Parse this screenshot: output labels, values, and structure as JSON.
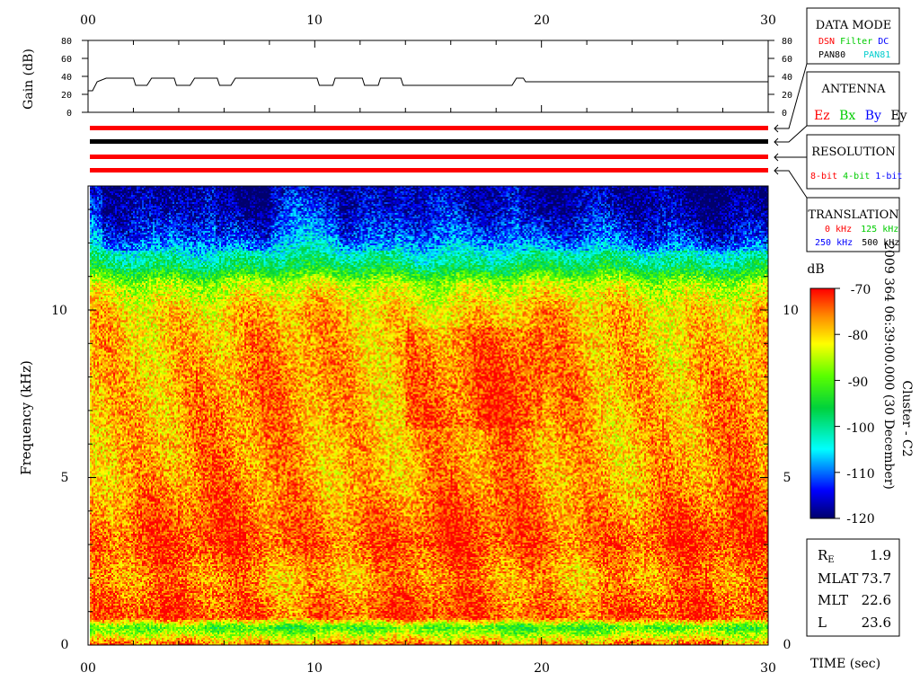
{
  "gain_panel": {
    "ylabel": "Gain (dB)",
    "yticks": [
      "0",
      "20",
      "40",
      "60",
      "80"
    ],
    "top_xticks": [
      "00",
      "10",
      "20",
      "30"
    ],
    "gain_profile": [
      [
        0,
        24
      ],
      [
        0.2,
        24
      ],
      [
        0.4,
        34
      ],
      [
        0.8,
        38
      ],
      [
        2,
        38
      ],
      [
        2.1,
        30
      ],
      [
        2.6,
        30
      ],
      [
        2.8,
        38
      ],
      [
        3.8,
        38
      ],
      [
        3.9,
        30
      ],
      [
        4.5,
        30
      ],
      [
        4.7,
        38
      ],
      [
        5.7,
        38
      ],
      [
        5.8,
        30
      ],
      [
        6.3,
        30
      ],
      [
        6.5,
        38
      ],
      [
        10.1,
        38
      ],
      [
        10.2,
        30
      ],
      [
        10.8,
        30
      ],
      [
        10.9,
        38
      ],
      [
        12.1,
        38
      ],
      [
        12.2,
        30
      ],
      [
        12.8,
        30
      ],
      [
        12.9,
        38
      ],
      [
        13.8,
        38
      ],
      [
        13.9,
        30
      ],
      [
        18.7,
        30
      ],
      [
        18.9,
        38
      ],
      [
        19.2,
        38
      ],
      [
        19.3,
        34
      ],
      [
        30,
        34
      ]
    ]
  },
  "status_bars": [
    {
      "color": "#ff0000"
    },
    {
      "color": "#000000"
    },
    {
      "color": "#ff0000"
    },
    {
      "color": "#ff0000"
    }
  ],
  "legend": {
    "data_mode": {
      "title": "DATA MODE",
      "items": [
        {
          "text": "DSN",
          "color": "#ff0000"
        },
        {
          "text": "Filter",
          "color": "#00cc00"
        },
        {
          "text": "DC",
          "color": "#0000ff"
        },
        {
          "text": "PAN80",
          "color": "#000000"
        },
        {
          "text": "PAN81",
          "color": "#00cccc"
        }
      ]
    },
    "antenna": {
      "title": "ANTENNA",
      "items": [
        {
          "text": "Ez",
          "color": "#ff0000"
        },
        {
          "text": "Bx",
          "color": "#00cc00"
        },
        {
          "text": "By",
          "color": "#0000ff"
        },
        {
          "text": "Ey",
          "color": "#000000"
        }
      ]
    },
    "resolution": {
      "title": "RESOLUTION",
      "items": [
        {
          "text": "8-bit",
          "color": "#ff0000"
        },
        {
          "text": "4-bit",
          "color": "#00cc00"
        },
        {
          "text": "1-bit",
          "color": "#0000ff"
        }
      ]
    },
    "translation": {
      "title": "TRANSLATION",
      "items": [
        {
          "text": "0 kHz",
          "color": "#ff0000"
        },
        {
          "text": "125 kHz",
          "color": "#00cc00"
        },
        {
          "text": "250 kHz",
          "color": "#0000ff"
        },
        {
          "text": "500 kHz",
          "color": "#000000"
        }
      ]
    }
  },
  "colorbar": {
    "label": "dB",
    "ticks": [
      "-70",
      "-80",
      "-90",
      "-100",
      "-110",
      "-120"
    ],
    "vmin": -120,
    "vmax": -70
  },
  "side_caption": {
    "line1": "2009 364 06:39:00.000 (30 December)",
    "line2": "Cluster - C2"
  },
  "orbit_table": [
    {
      "label_main": "R",
      "label_sub": "E",
      "value": "1.9"
    },
    {
      "label_main": "MLAT",
      "label_sub": "",
      "value": "73.7"
    },
    {
      "label_main": "MLT",
      "label_sub": "",
      "value": "22.6"
    },
    {
      "label_main": "L",
      "label_sub": "",
      "value": "23.6"
    }
  ],
  "chart_data": {
    "type": "heatmap",
    "xlabel": "TIME (sec)",
    "ylabel": "Frequency (kHz)",
    "xlim": [
      0,
      30
    ],
    "ylim": [
      0,
      13.7
    ],
    "xticks": [
      "00",
      "10",
      "20",
      "30"
    ],
    "yticks": [
      "0",
      "5",
      "10"
    ],
    "zlabel": "dB",
    "zlim": [
      -120,
      -70
    ],
    "colormap": "rainbow (blue low, red high)",
    "frequency_profile_db": [
      {
        "f": 0.0,
        "db": -76
      },
      {
        "f": 0.5,
        "db": -92
      },
      {
        "f": 0.8,
        "db": -73
      },
      {
        "f": 2.0,
        "db": -77
      },
      {
        "f": 3.0,
        "db": -73
      },
      {
        "f": 5.0,
        "db": -77
      },
      {
        "f": 8.0,
        "db": -77
      },
      {
        "f": 10.0,
        "db": -79
      },
      {
        "f": 10.8,
        "db": -85
      },
      {
        "f": 11.3,
        "db": -97
      },
      {
        "f": 12.2,
        "db": -109
      },
      {
        "f": 13.0,
        "db": -114
      },
      {
        "f": 13.7,
        "db": -116
      }
    ]
  }
}
